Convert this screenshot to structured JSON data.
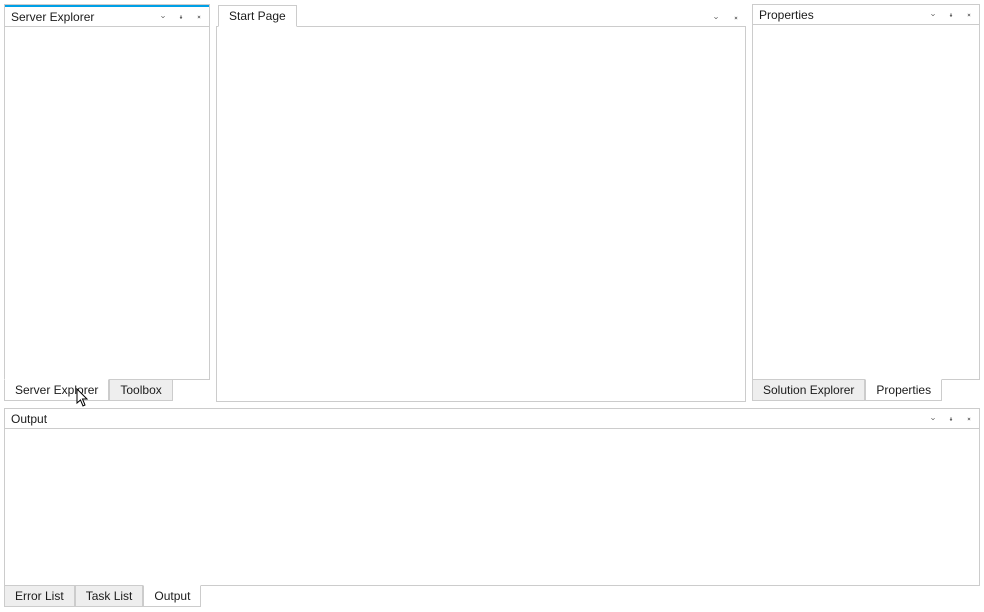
{
  "left_panel": {
    "title": "Server Explorer",
    "tabs": [
      {
        "label": "Server Explorer",
        "active": true
      },
      {
        "label": "Toolbox",
        "active": false
      }
    ]
  },
  "center_panel": {
    "tab_label": "Start Page"
  },
  "right_panel": {
    "title": "Properties",
    "tabs": [
      {
        "label": "Solution Explorer",
        "active": false
      },
      {
        "label": "Properties",
        "active": true
      }
    ]
  },
  "output_panel": {
    "title": "Output",
    "tabs": [
      {
        "label": "Error List",
        "active": false
      },
      {
        "label": "Task List",
        "active": false
      },
      {
        "label": "Output",
        "active": true
      }
    ]
  }
}
